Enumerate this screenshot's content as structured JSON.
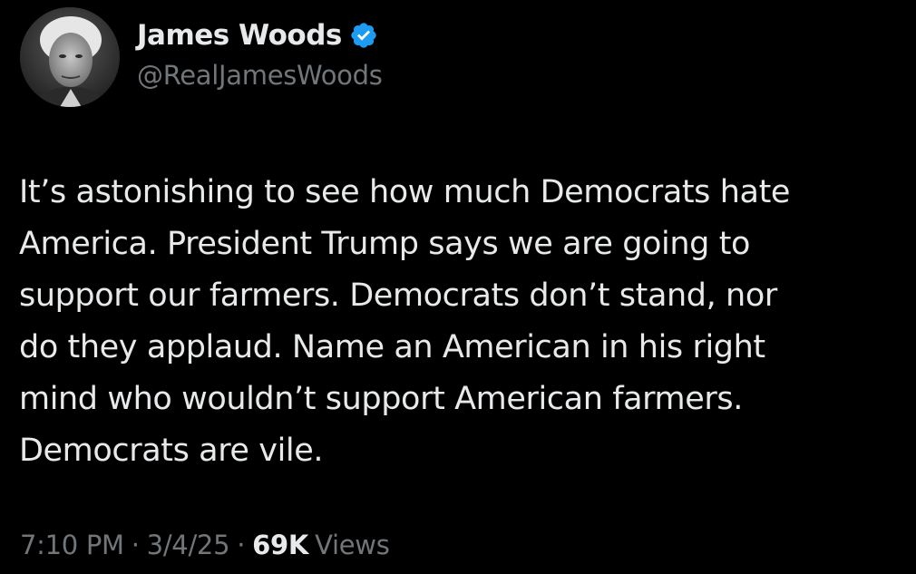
{
  "author": {
    "display_name": "James Woods",
    "handle": "@RealJamesWoods",
    "verified": true,
    "avatar_icon": "profile-photo-grayscale",
    "verified_icon": "verified-badge-icon"
  },
  "tweet": {
    "text": "It’s astonishing to see how much Democrats hate\nAmerica. President Trump says we are going to\nsupport our farmers. Democrats don’t stand, nor\ndo they applaud. Name an American in his right\nmind who wouldn’t support American farmers.\nDemocrats are vile."
  },
  "meta": {
    "time": "7:10 PM",
    "separator": "·",
    "date": "3/4/25",
    "views_count": "69K",
    "views_label": "Views"
  },
  "colors": {
    "background": "#000000",
    "primary_text": "#e7e9ea",
    "secondary_text": "#71767b",
    "verified_blue": "#1d9bf0"
  }
}
